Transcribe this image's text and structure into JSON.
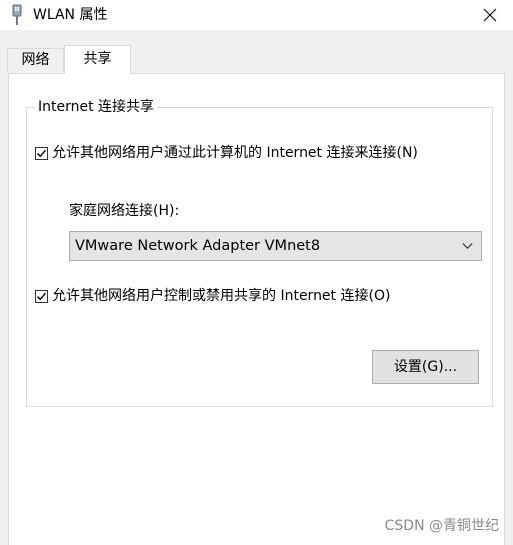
{
  "window": {
    "title": "WLAN 属性",
    "close_icon": "close-icon",
    "app_icon": "network-adapter-icon"
  },
  "tabs": [
    {
      "label": "网络",
      "selected": false
    },
    {
      "label": "共享",
      "selected": true
    }
  ],
  "ics": {
    "group_title": "Internet 连接共享",
    "allow_connect": {
      "label": "允许其他网络用户通过此计算机的 Internet 连接来连接(N)",
      "checked": true
    },
    "home_network_label": "家庭网络连接(H):",
    "home_network_value": "VMware Network Adapter VMnet8",
    "allow_control": {
      "label": "允许其他网络用户控制或禁用共享的 Internet 连接(O)",
      "checked": true
    },
    "settings_button": "设置(G)..."
  },
  "watermark": "CSDN @青铜世纪"
}
